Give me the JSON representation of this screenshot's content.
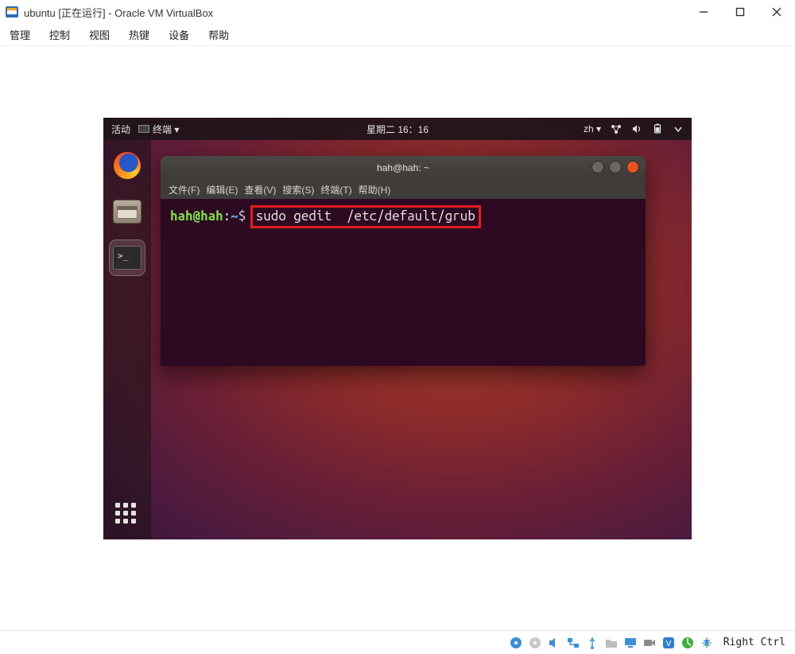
{
  "window": {
    "title": "ubuntu [正在运行] - Oracle VM VirtualBox"
  },
  "win_menu": {
    "manage": "管理",
    "control": "控制",
    "view": "视图",
    "hotkeys": "热键",
    "devices": "设备",
    "help": "帮助"
  },
  "ubuntu": {
    "activities": "活动",
    "app_indicator": "终端 ▾",
    "datetime": "星期二 16：16",
    "input_method": "zh ▾"
  },
  "terminal": {
    "title": "hah@hah: ~",
    "menu": {
      "file": "文件(F)",
      "edit": "编辑(E)",
      "view": "查看(V)",
      "search": "搜索(S)",
      "terminal": "终端(T)",
      "help": "帮助(H)"
    },
    "prompt": {
      "user_host": "hah@hah",
      "sep": ":",
      "path": "~",
      "symbol": "$"
    },
    "command": "sudo gedit  /etc/default/grub"
  },
  "statusbar": {
    "host_key": "Right Ctrl"
  }
}
